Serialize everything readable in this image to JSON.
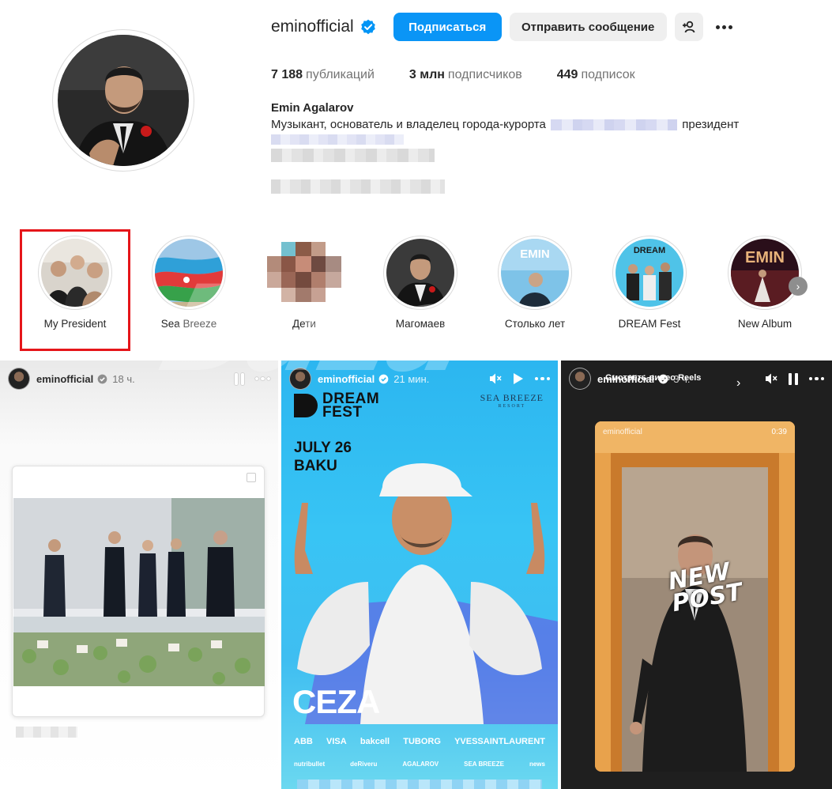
{
  "profile": {
    "username": "eminofficial",
    "follow_label": "Подписаться",
    "message_label": "Отправить сообщение",
    "stats": [
      {
        "value": "7 188",
        "label": "публикаций"
      },
      {
        "value": "3 млн",
        "label": "подписчиков"
      },
      {
        "value": "449",
        "label": "подписок"
      }
    ],
    "full_name": "Emin Agalarov",
    "bio_prefix": "Музыкант, основатель и владелец города-курорта",
    "bio_suffix": "президент"
  },
  "highlights": [
    {
      "label": "My President",
      "selected": true
    },
    {
      "label": "Sea Breeze"
    },
    {
      "label": "Дети"
    },
    {
      "label": "Магомаев"
    },
    {
      "label": "Столько лет"
    },
    {
      "label": "DREAM Fest"
    },
    {
      "label": "New Album"
    }
  ],
  "stories": [
    {
      "user": "eminofficial",
      "time": "18 ч."
    },
    {
      "user": "eminofficial",
      "time": "21 мин.",
      "festival": [
        "DREAM",
        "FEST"
      ],
      "date": [
        "JULY 26",
        "BAKU"
      ],
      "brand": "SEA BREEZE",
      "brand_sub": "RESORT",
      "artist": "CEZA",
      "sponsors": [
        "ABB",
        "VISA",
        "bakcell",
        "TUBORG",
        "YVESSAINTLAURENT"
      ],
      "sponsors2": [
        "nutribullet",
        "deRiveru",
        "AGALAROV",
        "SEA BREEZE",
        "news"
      ]
    },
    {
      "user": "eminofficial",
      "time": "3 ч.",
      "subtitle": "Смотреть видео Reels",
      "reel_user": "eminofficial",
      "reel_duration": "0:39",
      "overlay": [
        "NEW",
        "POST"
      ]
    }
  ],
  "watermark": "Baza",
  "colors": {
    "primary": "#0a95f6",
    "highlight_border": "#e5151a",
    "verified": "#0095f6"
  }
}
